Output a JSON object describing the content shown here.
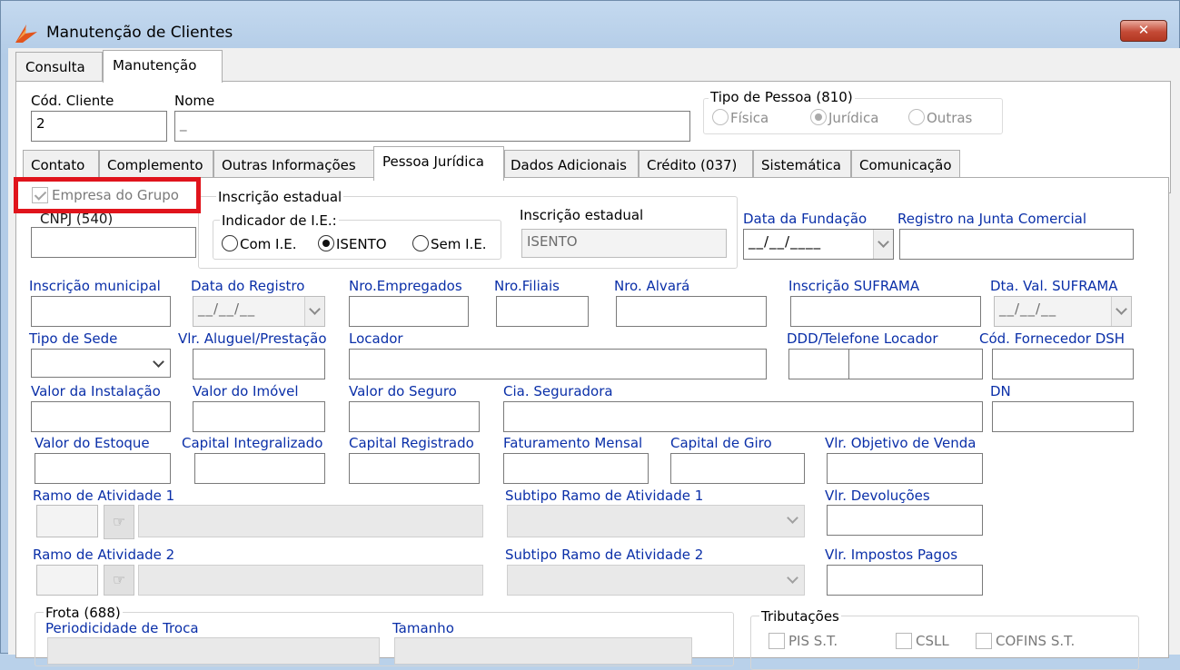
{
  "window": {
    "title": "Manutenção de Clientes",
    "close_icon": "close-x-icon"
  },
  "main_tabs": [
    {
      "label": "Consulta"
    },
    {
      "label": "Manutenção"
    }
  ],
  "header": {
    "cod_cliente_label": "Cód. Cliente",
    "cod_cliente_value": "2",
    "nome_label": "Nome",
    "nome_value": "_",
    "tipo_pessoa": {
      "title": "Tipo de Pessoa (810)",
      "options": [
        "Física",
        "Jurídica",
        "Outras"
      ],
      "selected": "Jurídica"
    }
  },
  "sub_tabs": [
    {
      "label": "Contato"
    },
    {
      "label": "Complemento"
    },
    {
      "label": "Outras Informações"
    },
    {
      "label": "Pessoa Jurídica"
    },
    {
      "label": "Dados Adicionais"
    },
    {
      "label": "Crédito (037)"
    },
    {
      "label": "Sistemática"
    },
    {
      "label": "Comunicação"
    }
  ],
  "pj": {
    "empresa_grupo_label": "Empresa do Grupo",
    "cnpj_label": "CNPJ (540)",
    "inscricao_estadual_group": "Inscrição estadual",
    "indicador_ie_label": "Indicador de I.E.:",
    "ie_options": [
      "Com I.E.",
      "ISENTO",
      "Sem I.E."
    ],
    "ie_selected": "ISENTO",
    "inscricao_estadual_label": "Inscrição estadual",
    "inscricao_estadual_value": "ISENTO",
    "data_fundacao_label": "Data da Fundação",
    "date_mask": "__/__/____",
    "date_mask_short": "__/__/__",
    "registro_junta_label": "Registro na Junta Comercial",
    "inscricao_municipal_label": "Inscrição municipal",
    "data_registro_label": "Data do Registro",
    "nro_empregados_label": "Nro.Empregados",
    "nro_filiais_label": "Nro.Filiais",
    "nro_alvara_label": "Nro. Alvará",
    "inscricao_suframa_label": "Inscrição SUFRAMA",
    "dta_val_suframa_label": "Dta. Val. SUFRAMA",
    "tipo_sede_label": "Tipo de Sede",
    "vlr_aluguel_label": "Vlr. Aluguel/Prestação",
    "locador_label": "Locador",
    "ddd_telefone_label": "DDD/Telefone Locador",
    "cod_fornecedor_label": "Cód. Fornecedor DSH",
    "valor_instalacao_label": "Valor da Instalação",
    "valor_imovel_label": "Valor do Imóvel",
    "valor_seguro_label": "Valor do Seguro",
    "cia_seguradora_label": "Cia. Seguradora",
    "dn_label": "DN",
    "valor_estoque_label": "Valor do Estoque",
    "capital_integralizado_label": "Capital Integralizado",
    "capital_registrado_label": "Capital Registrado",
    "faturamento_label": "Faturamento Mensal",
    "capital_giro_label": "Capital de Giro",
    "vlr_objetivo_label": "Vlr. Objetivo de Venda",
    "ramo1_label": "Ramo de Atividade 1",
    "subtipo1_label": "Subtipo Ramo de Atividade 1",
    "vlr_devolucoes_label": "Vlr. Devoluções",
    "ramo2_label": "Ramo de Atividade 2",
    "subtipo2_label": "Subtipo Ramo de Atividade 2",
    "vlr_impostos_label": "Vlr. Impostos Pagos",
    "frota_title": "Frota (688)",
    "periodicidade_label": "Periodicidade de Troca",
    "tamanho_label": "Tamanho",
    "tributacoes_title": "Tributações",
    "tributacoes": [
      "PIS S.T.",
      "CSLL",
      "COFINS S.T."
    ],
    "lookup_icon": "pointing-hand-icon"
  }
}
